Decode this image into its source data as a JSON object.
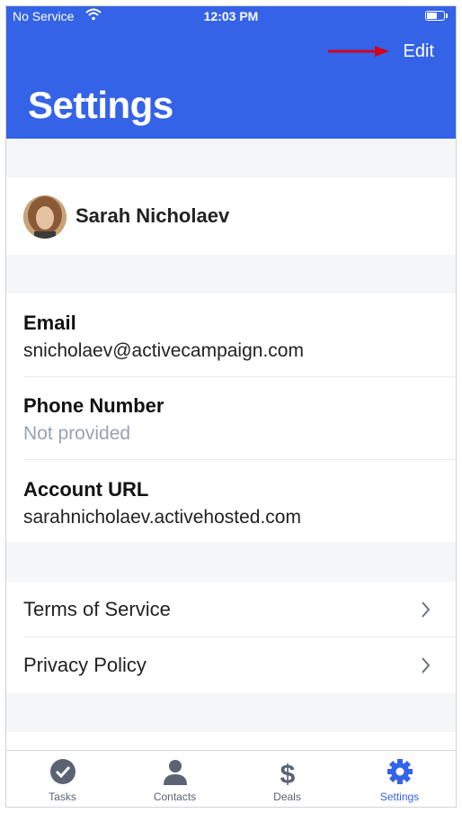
{
  "status_bar": {
    "carrier": "No Service",
    "time": "12:03 PM"
  },
  "header": {
    "edit_label": "Edit",
    "title": "Settings"
  },
  "profile": {
    "name": "Sarah Nicholaev"
  },
  "account_info": [
    {
      "label": "Email",
      "value": "snicholaev@activecampaign.com",
      "muted": false
    },
    {
      "label": "Phone Number",
      "value": "Not provided",
      "muted": true
    },
    {
      "label": "Account URL",
      "value": "sarahnicholaev.activehosted.com",
      "muted": false
    }
  ],
  "links": [
    {
      "label": "Terms of Service",
      "icon": "chevron-right-icon"
    },
    {
      "label": "Privacy Policy",
      "icon": "chevron-right-icon"
    }
  ],
  "tabs": [
    {
      "label": "Tasks",
      "icon": "check-circle-icon",
      "active": false
    },
    {
      "label": "Contacts",
      "icon": "person-icon",
      "active": false
    },
    {
      "label": "Deals",
      "icon": "dollar-icon",
      "active": false
    },
    {
      "label": "Settings",
      "icon": "gear-icon",
      "active": true
    }
  ],
  "colors": {
    "brand_blue": "#3463e8",
    "muted_text": "#98a2b3",
    "arrow_red": "#d0021b"
  }
}
